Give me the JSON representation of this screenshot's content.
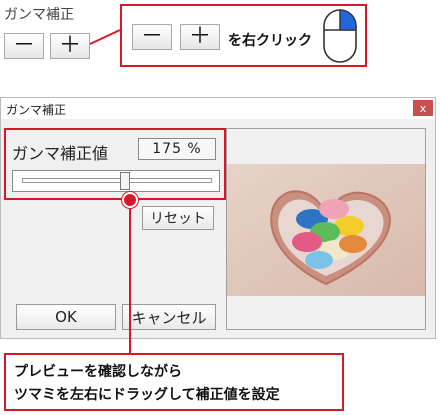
{
  "toolbar": {
    "label": "ガンマ補正",
    "minus_label": "－",
    "plus_label": "＋"
  },
  "callout_top": {
    "minus_label": "－",
    "plus_label": "＋",
    "text": "を右クリック"
  },
  "dialog": {
    "title": "ガンマ補正",
    "close_label": "x",
    "gamma_label": "ガンマ補正値",
    "gamma_value": "175 %",
    "slider_value_fraction": 0.56,
    "reset_label": "リセット",
    "ok_label": "OK",
    "cancel_label": "キャンセル"
  },
  "callout_bottom": {
    "line1": "プレビューを確認しながら",
    "line2": "ツマミを左右にドラッグして補正値を設定"
  },
  "colors": {
    "accent": "#d8182a",
    "close_button": "#c75050",
    "dialog_bg": "#f0f0f0"
  },
  "icons": {
    "mouse": "mouse-right-click-icon",
    "preview": "macarons-photo"
  }
}
